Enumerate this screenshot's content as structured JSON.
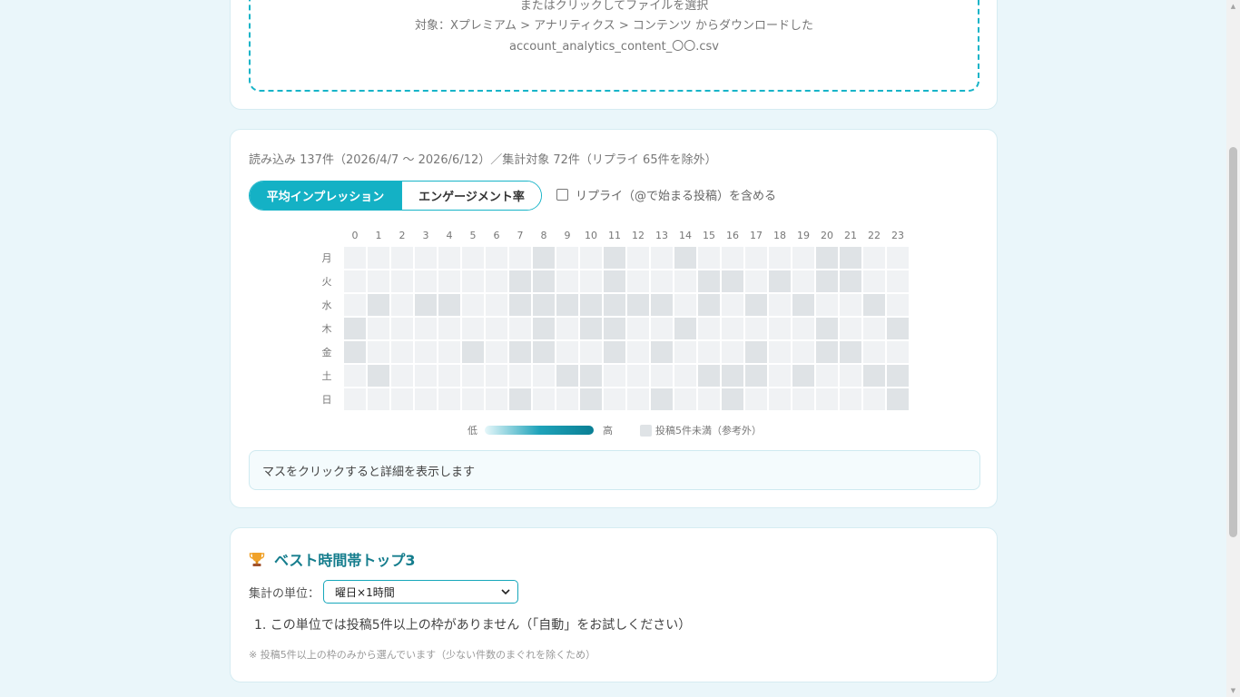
{
  "upload": {
    "line1": "またはクリックしてファイルを選択",
    "line2": "対象：Xプレミアム > アナリティクス > コンテンツ からダウンロードした",
    "line3": "account_analytics_content_〇〇.csv"
  },
  "heatmap": {
    "summary": "読み込み 137件（2026/4/7 〜 2026/6/12）／集計対象 72件（リプライ 65件を除外）",
    "tabs": [
      "平均インプレッション",
      "エンゲージメント率"
    ],
    "active_tab": 0,
    "include_replies_label": "リプライ（@で始まる投稿）を含める",
    "include_replies_checked": false,
    "hours": [
      "0",
      "1",
      "2",
      "3",
      "4",
      "5",
      "6",
      "7",
      "8",
      "9",
      "10",
      "11",
      "12",
      "13",
      "14",
      "15",
      "16",
      "17",
      "18",
      "19",
      "20",
      "21",
      "22",
      "23"
    ],
    "days": [
      "月",
      "火",
      "水",
      "木",
      "金",
      "土",
      "日"
    ],
    "cells": [
      [
        0,
        0,
        0,
        0,
        0,
        0,
        0,
        0,
        1,
        0,
        0,
        1,
        0,
        0,
        1,
        0,
        0,
        0,
        0,
        0,
        1,
        1,
        0,
        0
      ],
      [
        0,
        0,
        0,
        0,
        0,
        0,
        0,
        1,
        1,
        0,
        0,
        1,
        0,
        0,
        0,
        1,
        1,
        0,
        1,
        0,
        1,
        1,
        0,
        0
      ],
      [
        0,
        1,
        0,
        1,
        1,
        0,
        0,
        1,
        1,
        1,
        1,
        1,
        1,
        1,
        0,
        1,
        0,
        1,
        0,
        1,
        0,
        0,
        1,
        0
      ],
      [
        1,
        0,
        0,
        0,
        0,
        0,
        0,
        0,
        1,
        0,
        1,
        1,
        0,
        0,
        1,
        0,
        0,
        0,
        0,
        0,
        1,
        0,
        0,
        1
      ],
      [
        1,
        0,
        0,
        0,
        0,
        1,
        0,
        1,
        1,
        0,
        0,
        1,
        0,
        1,
        0,
        0,
        0,
        1,
        0,
        0,
        1,
        1,
        0,
        0
      ],
      [
        0,
        1,
        0,
        0,
        0,
        0,
        0,
        0,
        0,
        1,
        1,
        0,
        0,
        0,
        0,
        1,
        1,
        1,
        0,
        1,
        0,
        0,
        1,
        1
      ],
      [
        0,
        0,
        0,
        0,
        0,
        0,
        0,
        1,
        0,
        0,
        1,
        0,
        0,
        1,
        0,
        0,
        1,
        0,
        0,
        0,
        0,
        0,
        0,
        1
      ]
    ],
    "cell_colors": {
      "empty": "#f0f2f4",
      "under_five": "#dfe3e6"
    },
    "legend": {
      "low": "低",
      "high": "高",
      "na": "投稿5件未満（参考外）"
    },
    "detail_hint": "マスをクリックすると詳細を表示します"
  },
  "top3": {
    "title": "ベスト時間帯トップ3",
    "unit_label": "集計の単位：",
    "unit_value": "曜日×1時間",
    "items": [
      "1. この単位では投稿5件以上の枠がありません（「自動」をお試しください）"
    ],
    "note": "※ 投稿5件以上の枠のみから選んでいます（少ない件数のまぐれを除くため）"
  },
  "icons": {
    "trophy": "trophy-icon",
    "select_chevron": "chevron-down-icon",
    "scroll_up": "scroll-up-icon",
    "scroll_down": "scroll-down-icon"
  },
  "colors": {
    "accent": "#14b1c5",
    "title": "#157d8d",
    "background": "#eaf6fa"
  }
}
